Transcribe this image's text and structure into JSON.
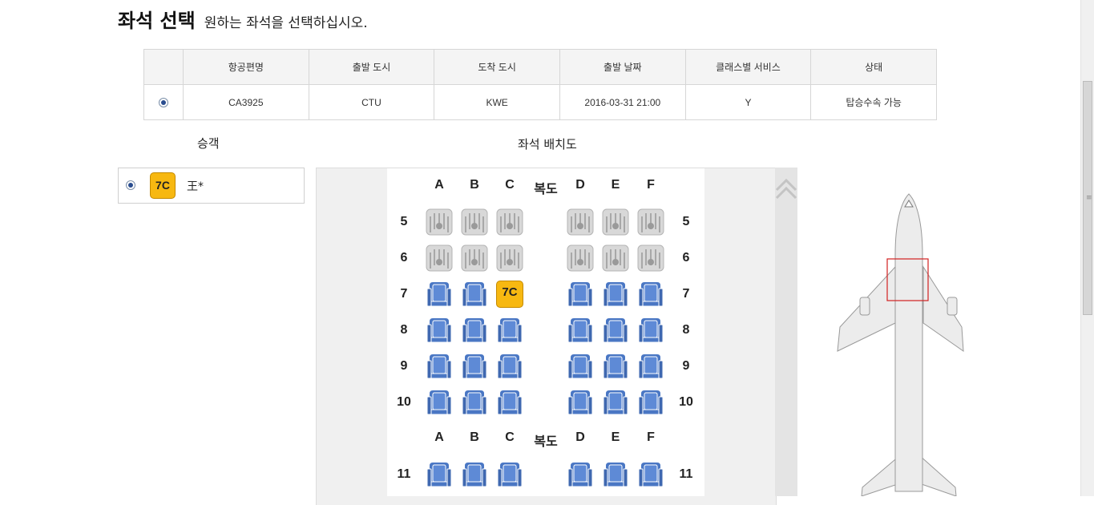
{
  "page": {
    "title": "좌석 선택",
    "subtitle": "원하는 좌석을 선택하십시오."
  },
  "flight_table": {
    "headers": [
      "",
      "항공편명",
      "출발 도시",
      "도착 도시",
      "출발 날짜",
      "클래스별 서비스",
      "상태"
    ],
    "row": {
      "selected": true,
      "flight": "CA3925",
      "from": "CTU",
      "to": "KWE",
      "date": "2016-03-31 21:00",
      "class": "Y",
      "status": "탑승수속 가능"
    }
  },
  "passengers": {
    "label": "승객",
    "items": [
      {
        "seat": "7C",
        "name": "王*",
        "selected": true
      }
    ]
  },
  "seatmap": {
    "label": "좌석 배치도",
    "columns_left": [
      "A",
      "B",
      "C"
    ],
    "aisle_label": "복도",
    "columns_right": [
      "D",
      "E",
      "F"
    ],
    "rows": [
      {
        "row": "5",
        "seats": [
          "occupied",
          "occupied",
          "occupied",
          "occupied",
          "occupied",
          "occupied"
        ]
      },
      {
        "row": "6",
        "seats": [
          "occupied",
          "occupied",
          "occupied",
          "occupied",
          "occupied",
          "occupied"
        ]
      },
      {
        "row": "7",
        "seats": [
          "available",
          "available",
          "selected",
          "available",
          "available",
          "available"
        ],
        "selected_label": "7C"
      },
      {
        "row": "8",
        "seats": [
          "available",
          "available",
          "available",
          "available",
          "available",
          "available"
        ]
      },
      {
        "row": "9",
        "seats": [
          "available",
          "available",
          "available",
          "available",
          "available",
          "available"
        ]
      },
      {
        "row": "10",
        "seats": [
          "available",
          "available",
          "available",
          "available",
          "available",
          "available"
        ]
      },
      {
        "row": "11",
        "seats": [
          "available",
          "available",
          "available",
          "available",
          "available",
          "available"
        ]
      }
    ],
    "colors": {
      "available": "#4a77c4",
      "occupied": "#d2d2d2",
      "selected": "#f7b811",
      "minimap_marker": "#d32020"
    }
  }
}
